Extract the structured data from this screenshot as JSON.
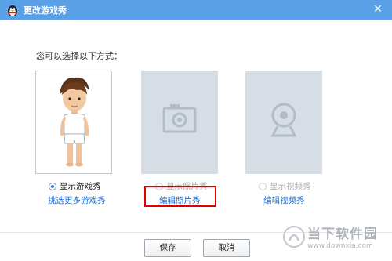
{
  "window": {
    "title": "更改游戏秀",
    "close_symbol": "✕",
    "title_bar_color": "#5aa0e6"
  },
  "instruction": "您可以选择以下方式：",
  "options": [
    {
      "radio_label": "显示游戏秀",
      "link_label": "挑选更多游戏秀",
      "checked": true
    },
    {
      "radio_label": "显示照片秀",
      "link_label": "编辑照片秀",
      "checked": false
    },
    {
      "radio_label": "显示视频秀",
      "link_label": "编辑视频秀",
      "checked": false
    }
  ],
  "buttons": {
    "save": "保存",
    "cancel": "取消"
  },
  "watermark": {
    "name": "当下软件园",
    "url": "www.downxia.com"
  },
  "colors": {
    "link": "#1c6fd6",
    "highlight": "#e10000",
    "card_gray": "#d6dde5"
  },
  "icons": {
    "avatar": "cartoon-boy-avatar",
    "photo": "camera-icon",
    "video": "webcam-icon"
  }
}
